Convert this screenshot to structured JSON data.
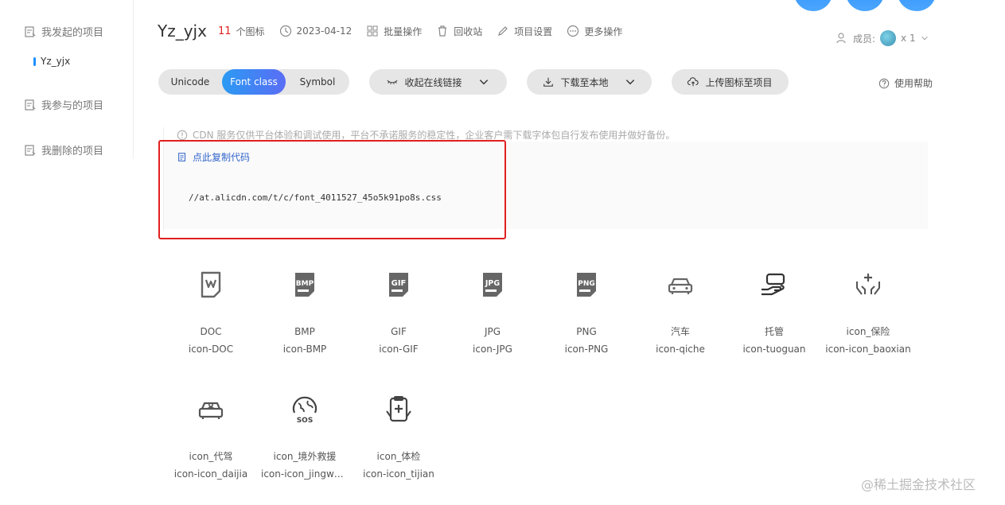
{
  "sidebar": {
    "items": [
      {
        "label": "我发起的项目"
      },
      {
        "label": "我参与的项目"
      },
      {
        "label": "我删除的项目"
      }
    ],
    "sub_item": "Yz_yjx"
  },
  "header": {
    "title": "Yz_yjx",
    "icon_count": "11",
    "icon_count_label": "个图标",
    "date": "2023-04-12",
    "batch": "批量操作",
    "recycle": "回收站",
    "settings": "项目设置",
    "more": "更多操作",
    "members_label": "成员:",
    "members_count": "x 1"
  },
  "toolbar": {
    "tabs": [
      "Unicode",
      "Font class",
      "Symbol"
    ],
    "active_tab": "Font class",
    "collapse_link": "收起在线链接",
    "download": "下载至本地",
    "upload": "上传图标至项目",
    "help": "使用帮助"
  },
  "notice": "CDN 服务仅供平台体验和调试使用，平台不承诺服务的稳定性，企业客户需下载字体包自行发布使用并做好备份。",
  "copy_code": "点此复制代码",
  "code": "//at.alicdn.com/t/c/font_4011527_45o5k91po8s.css",
  "icons": [
    {
      "name": "DOC",
      "code": "icon-DOC",
      "glyph": "doc-file-icon"
    },
    {
      "name": "BMP",
      "code": "icon-BMP",
      "glyph": "bmp-file-icon"
    },
    {
      "name": "GIF",
      "code": "icon-GIF",
      "glyph": "gif-file-icon"
    },
    {
      "name": "JPG",
      "code": "icon-JPG",
      "glyph": "jpg-file-icon"
    },
    {
      "name": "PNG",
      "code": "icon-PNG",
      "glyph": "png-file-icon"
    },
    {
      "name": "汽车",
      "code": "icon-qiche",
      "glyph": "car-icon"
    },
    {
      "name": "托管",
      "code": "icon-tuoguan",
      "glyph": "hand-holding-icon"
    },
    {
      "name": "icon_保险",
      "code": "icon-icon_baoxian",
      "glyph": "insurance-hands-icon"
    },
    {
      "name": "icon_代驾",
      "code": "icon-icon_daijia",
      "glyph": "designated-driver-icon"
    },
    {
      "name": "icon_境外救援",
      "code": "icon-icon_jingwa...",
      "glyph": "sos-globe-icon"
    },
    {
      "name": "icon_体检",
      "code": "icon-icon_tijian",
      "glyph": "medical-checkup-icon"
    }
  ],
  "watermark": "@稀土掘金技术社区",
  "colors": {
    "accent_gradient_start": "#2b9af3",
    "accent_gradient_end": "#5a6df5",
    "count_red": "#e02020",
    "highlight_box": "#e02020",
    "link_blue": "#3366cc"
  }
}
